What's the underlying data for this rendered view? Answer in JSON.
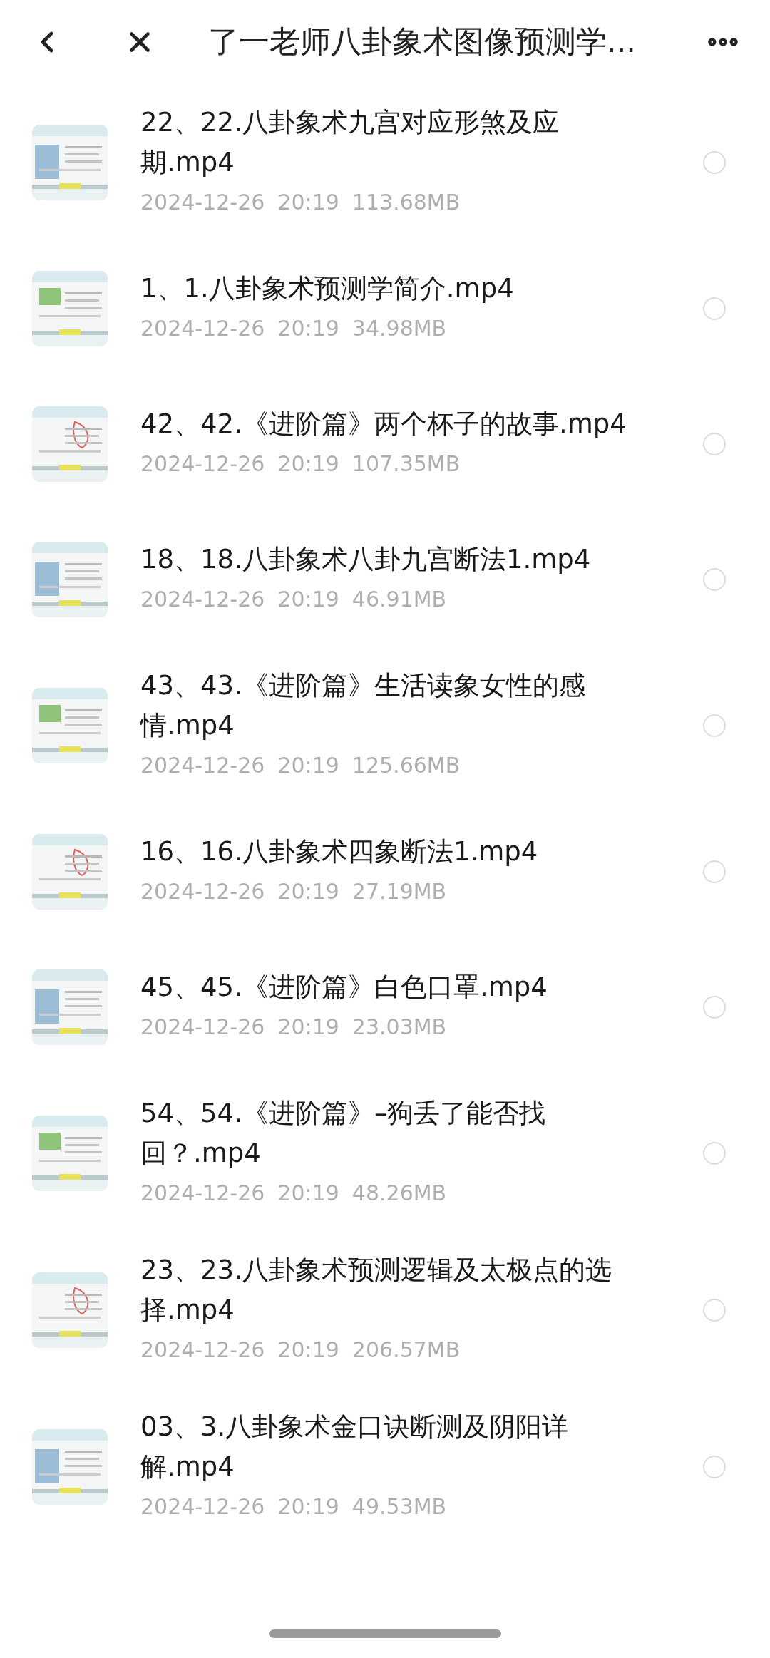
{
  "header": {
    "title": "了一老师八卦象术图像预测学..."
  },
  "files": [
    {
      "title_lines": [
        "22、22.八卦象术九宫对应形煞及应",
        "期.mp4"
      ],
      "date": "2024-12-26",
      "time": "20:19",
      "size": "113.68MB",
      "selected": false
    },
    {
      "title_lines": [
        "1、1.八卦象术预测学简介.mp4"
      ],
      "date": "2024-12-26",
      "time": "20:19",
      "size": "34.98MB",
      "selected": false
    },
    {
      "title_lines": [
        "42、42.《进阶篇》两个杯子的故事.mp4"
      ],
      "date": "2024-12-26",
      "time": "20:19",
      "size": "107.35MB",
      "selected": false
    },
    {
      "title_lines": [
        "18、18.八卦象术八卦九宫断法1.mp4"
      ],
      "date": "2024-12-26",
      "time": "20:19",
      "size": "46.91MB",
      "selected": false
    },
    {
      "title_lines": [
        "43、43.《进阶篇》生活读象女性的感",
        "情.mp4"
      ],
      "date": "2024-12-26",
      "time": "20:19",
      "size": "125.66MB",
      "selected": false
    },
    {
      "title_lines": [
        "16、16.八卦象术四象断法1.mp4"
      ],
      "date": "2024-12-26",
      "time": "20:19",
      "size": "27.19MB",
      "selected": false
    },
    {
      "title_lines": [
        "45、45.《进阶篇》白色口罩.mp4"
      ],
      "date": "2024-12-26",
      "time": "20:19",
      "size": "23.03MB",
      "selected": false
    },
    {
      "title_lines": [
        "54、54.《进阶篇》–狗丢了能否找",
        "回？.mp4"
      ],
      "date": "2024-12-26",
      "time": "20:19",
      "size": "48.26MB",
      "selected": false
    },
    {
      "title_lines": [
        "23、23.八卦象术预测逻辑及太极点的选",
        "择.mp4"
      ],
      "date": "2024-12-26",
      "time": "20:19",
      "size": "206.57MB",
      "selected": false
    },
    {
      "title_lines": [
        "03、3.八卦象术金口诀断测及阴阳详",
        "解.mp4"
      ],
      "date": "2024-12-26",
      "time": "20:19",
      "size": "49.53MB",
      "selected": false
    }
  ]
}
